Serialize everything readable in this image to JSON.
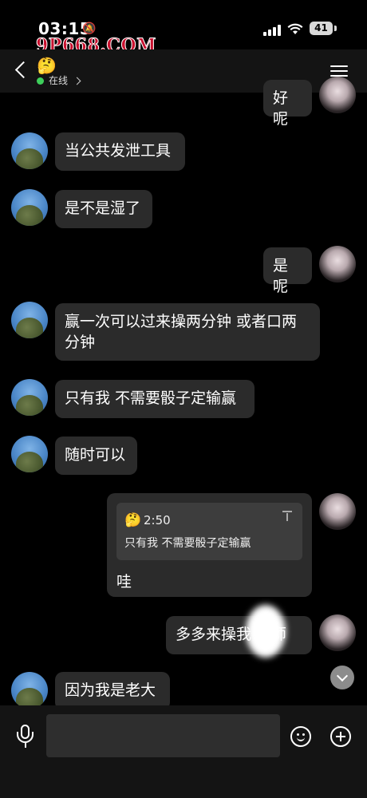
{
  "status_bar": {
    "time": "03:15",
    "battery": "41",
    "watermark": "9P668.COM"
  },
  "header": {
    "contact_emoji": "🤔",
    "status": "在线"
  },
  "messages": [
    {
      "side": "right",
      "text": "好呢"
    },
    {
      "side": "left",
      "text": "当公共发泄工具"
    },
    {
      "side": "left",
      "text": "是不是湿了"
    },
    {
      "side": "right",
      "text": "是呢"
    },
    {
      "side": "left",
      "text": "赢一次可以过来操两分钟 或者口两分钟"
    },
    {
      "side": "left",
      "text": "只有我 不需要骰子定输赢"
    },
    {
      "side": "left",
      "text": "随时可以"
    },
    {
      "side": "right",
      "text": "哇",
      "quote": {
        "emoji": "🤔",
        "time": "2:50",
        "text": "只有我 不需要骰子定输赢"
      }
    },
    {
      "side": "right",
      "text": "多多来操我         老师"
    },
    {
      "side": "left",
      "text": "因为我是老大"
    }
  ],
  "input": {
    "value": "",
    "placeholder": ""
  },
  "colors": {
    "background": "#000000",
    "bubble": "#2b2b2b",
    "online_dot": "#3ecf5b",
    "watermark": "#c8102e"
  },
  "icons": [
    "back-icon",
    "menu-icon",
    "mic-icon",
    "emoji-icon",
    "plus-icon",
    "scroll-down-icon",
    "bell-slash-icon",
    "wifi-icon",
    "signal-icon"
  ]
}
